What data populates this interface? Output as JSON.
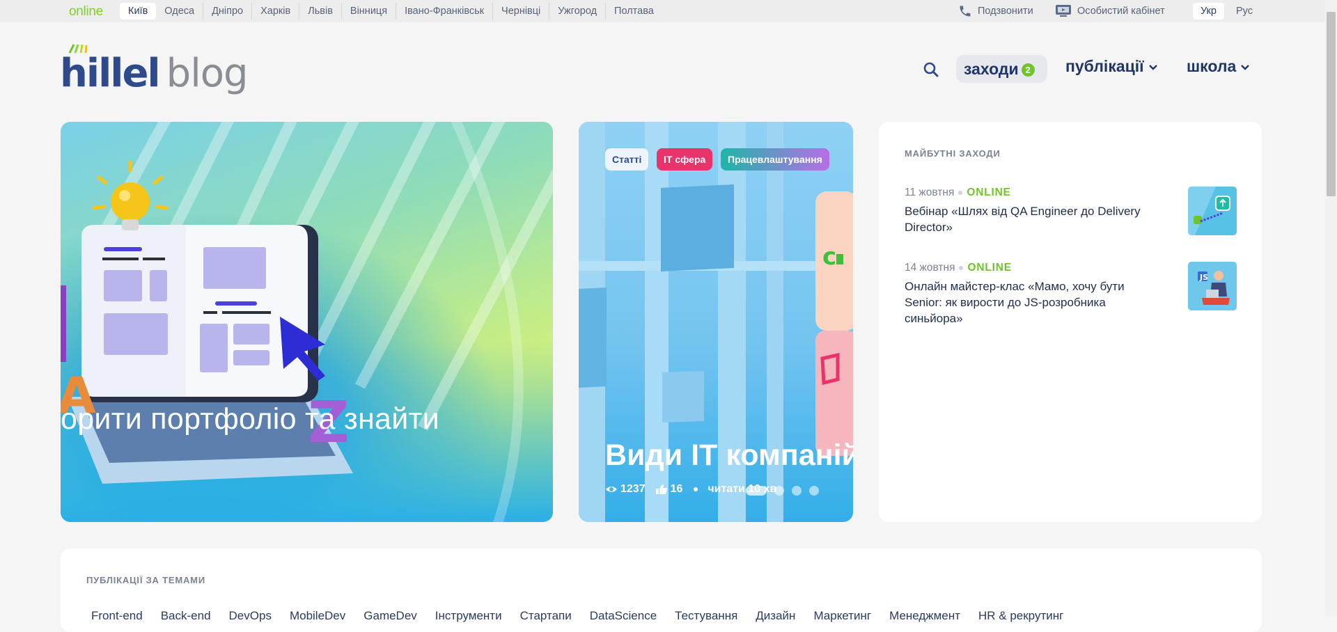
{
  "topbar": {
    "online": "online",
    "cities": [
      "Київ",
      "Одеса",
      "Дніпро",
      "Харків",
      "Львів",
      "Вінниця",
      "Івано-Франківськ",
      "Чернівці",
      "Ужгород",
      "Полтава"
    ],
    "active_city": "Київ",
    "call": "Подзвонити",
    "cabinet": "Особистий кабінет",
    "lang_ukr": "Укр",
    "lang_rus": "Рус"
  },
  "logo": {
    "hillel": "hillel",
    "blog": "blog"
  },
  "nav": {
    "events_label": "заходи",
    "events_count": "2",
    "publications": "публікації",
    "school": "школа"
  },
  "hero": {
    "left_title": "орити портфоліо та знайти",
    "tags": [
      "Статті",
      "IT сфера",
      "Працевлаштування"
    ],
    "mid_title": "Види IT компаній",
    "views": "1237",
    "likes": "16",
    "read_time": "читати 10 хв",
    "slide_count": 4,
    "active_slide": 1
  },
  "events": {
    "heading": "МАЙБУТНІ ЗАХОДИ",
    "items": [
      {
        "date": "11 жовтня",
        "format": "ONLINE",
        "title": "Вебінар «Шлях від QA Engineer до Delivery Director»"
      },
      {
        "date": "14 жовтня",
        "format": "ONLINE",
        "title": "Онлайн майстер-клас «Мамо, хочу бути Senior: як вирости до JS-розробника синьйора»"
      }
    ]
  },
  "topics": {
    "heading": "ПУБЛІКАЦІЇ ЗА ТЕМАМИ",
    "items": [
      "Front-end",
      "Back-end",
      "DevOps",
      "MobileDev",
      "GameDev",
      "Інструменти",
      "Стартапи",
      "DataScience",
      "Тестування",
      "Дизайн",
      "Маркетинг",
      "Менеджмент",
      "HR & рекрутинг"
    ]
  },
  "colors": {
    "accent_green": "#6fc42a",
    "brand_blue": "#2f4a8c",
    "tag_pink": "#e8336b"
  }
}
